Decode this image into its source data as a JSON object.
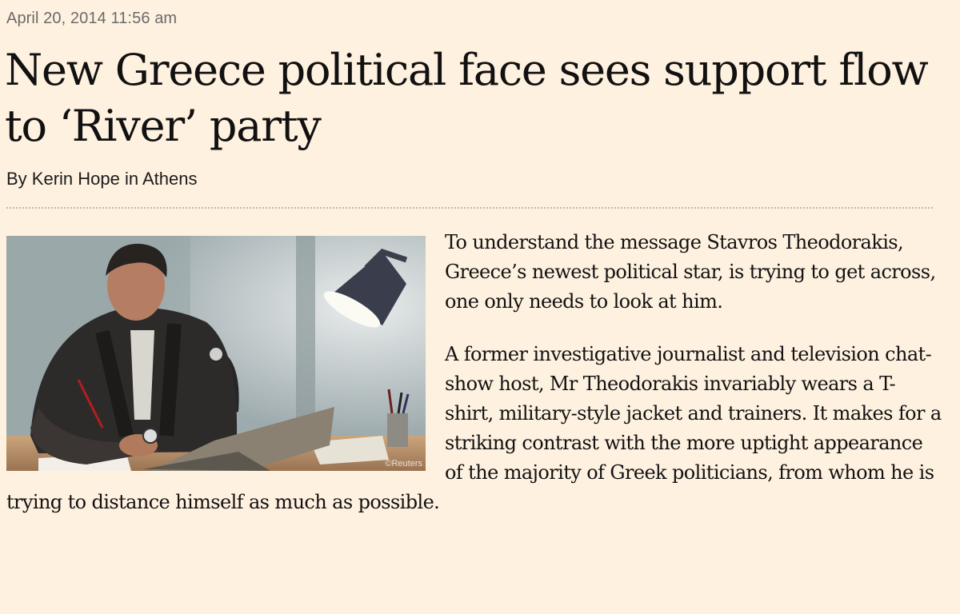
{
  "article": {
    "timestamp": "April 20, 2014 11:56 am",
    "headline": "New Greece political face sees support flow to ‘River’ party",
    "byline": "By Kerin Hope in Athens",
    "photo": {
      "credit": "©Reuters"
    },
    "paragraphs": [
      "To understand the message Stavros Theodorakis, Greece’s newest political star, is trying to get across, one only needs to look at him.",
      "A former investigative journalist and television chat-show host, Mr Theodorakis invariably wears a T-shirt, military-style jacket and trainers. It makes for a striking contrast with the more uptight appearance of the majority of Greek politicians, from whom he is trying to distance himself as much as possible."
    ]
  }
}
